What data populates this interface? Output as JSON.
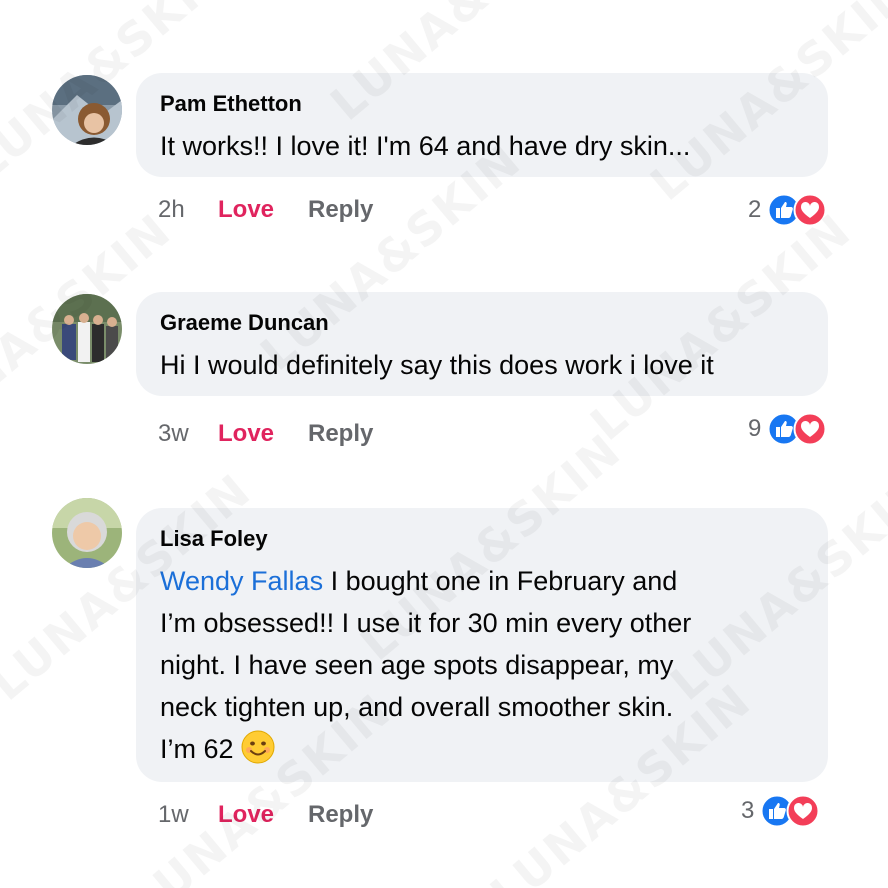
{
  "watermark": {
    "text": "LUNA&SKIN"
  },
  "comments": [
    {
      "author": "Pam Ethetton",
      "text": "It works!! I love it! I'm 64 and have dry skin...",
      "time": "2h",
      "love_label": "Love",
      "reply_label": "Reply",
      "reaction_count": "2",
      "reaction_icons": [
        "like-icon",
        "love-icon"
      ]
    },
    {
      "author": "Graeme Duncan",
      "text": "Hi I would definitely say this does work i love it",
      "time": "3w",
      "love_label": "Love",
      "reply_label": "Reply",
      "reaction_count": "9",
      "reaction_icons": [
        "like-icon",
        "love-icon"
      ]
    },
    {
      "author": "Lisa Foley",
      "mention": "Wendy Fallas",
      "text_lines": [
        " I bought one in February and",
        "I’m obsessed!! I use it for 30 min every other",
        "night.  I have seen age spots disappear, my",
        "neck tighten up, and overall smoother skin.",
        "I’m 62 "
      ],
      "emoji": "smiling-face-emoji",
      "time": "1w",
      "love_label": "Love",
      "reply_label": "Reply",
      "reaction_count": "3",
      "reaction_icons": [
        "like-icon",
        "love-icon"
      ]
    }
  ],
  "colors": {
    "bubble": "#f0f2f5",
    "love": "#e0245e",
    "muted": "#65676b",
    "mention": "#1b6fd8",
    "like_blue": "#1877f2",
    "heart_red": "#f33e58"
  }
}
